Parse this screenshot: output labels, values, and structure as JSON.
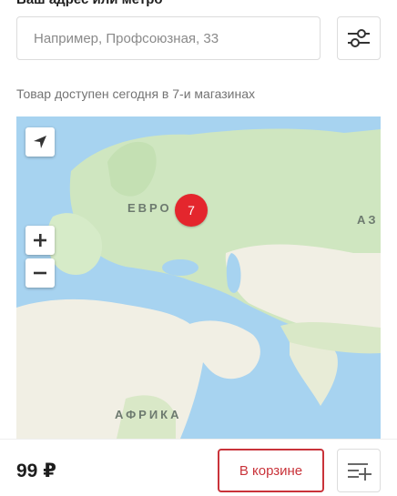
{
  "header": {
    "address_label": "Ваш адрес или метро"
  },
  "search": {
    "placeholder": "Например, Профсоюзная, 33",
    "value": ""
  },
  "filter": {
    "icon": "sliders-icon"
  },
  "availability": {
    "text": "Товар доступен сегодня в 7-и магазинах"
  },
  "map": {
    "labels": {
      "europe": "ЕВРО",
      "asia": "АЗ",
      "africa": "АФРИКА"
    },
    "cluster_count": "7",
    "controls": {
      "locate_icon": "location-arrow-icon",
      "zoom_in": "+",
      "zoom_out": "−"
    },
    "colors": {
      "water": "#a7d3f0",
      "land": "#cfe6c0",
      "desert": "#f1efe4",
      "cluster": "#e4262d"
    }
  },
  "purchase": {
    "price": "99 ₽",
    "cart_label": "В корзине",
    "cart_color": "#c9333a",
    "list_icon": "add-to-list-icon"
  }
}
